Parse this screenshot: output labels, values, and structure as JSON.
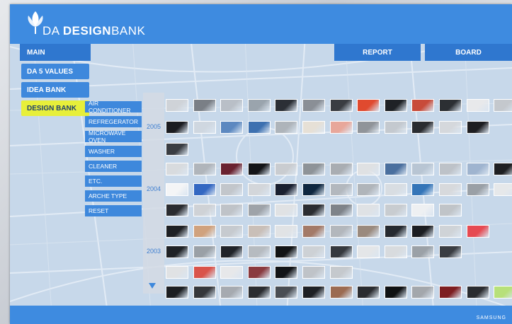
{
  "header": {
    "brand_prefix": "DA ",
    "brand_bold": "DESIGN",
    "brand_thin": "BANK",
    "logo_icon": "lotus-logo-icon"
  },
  "top_nav": {
    "main": "MAIN",
    "report": "REPORT",
    "board": "BOARD"
  },
  "left_nav": [
    "DA 5 VALUES",
    "IDEA BANK",
    "DESIGN BANK"
  ],
  "left_nav_active": "DESIGN BANK",
  "categories": [
    "AIR CONDITIONER",
    "REFREGERATOR",
    "MICROWAVE OVEN",
    "WASHER",
    "CLEANER",
    "ETC.",
    "ARCHE TYPE",
    "RESET"
  ],
  "years": [
    "2005",
    "2004",
    "2003"
  ],
  "bottom_text": "SAMSUNG",
  "colors": {
    "header_blue": "#3e8be0",
    "nav_blue": "#2f77cf",
    "active_yellow": "#e7ef3a",
    "map_bg": "#c9d9ea"
  },
  "thumb_rows": [
    [
      "#cfd3d8",
      "#7a7f86",
      "#b9bfc7",
      "#9aa4ad",
      "#2b2f36",
      "#8a8f96",
      "#3a3d42",
      "#e04a2f",
      "#1f2226",
      "#c84b3a",
      "#2c2f33",
      "#e8e9eb",
      "#c4c8cd",
      "#f3f3f4"
    ],
    [
      "#1b1c20",
      "#cfd7e0",
      "#5c88c0",
      "#3d70b0",
      "#aeb4ba",
      "#e6e0d6",
      "#e8a79a",
      "#909499",
      "#c4c9cf",
      "#2a2c30",
      "#d5d8dc",
      "#1d1d20"
    ],
    [
      "#3a3d42"
    ],
    [
      "#d8dbde",
      "#b0b5bb",
      "#6a2230",
      "#141518",
      "#c9ccd0",
      "#8e9398",
      "#a9adb2",
      "#dfe1e3",
      "#4a6f9e",
      "#b8c5d3",
      "#bdc2c8",
      "#9fb4cf",
      "#1e1f22"
    ],
    [
      "#f4f5f6",
      "#3468c2",
      "#c2c6cb",
      "#d3d6da",
      "#1a2030",
      "#0f2740",
      "#b3b8be",
      "#b0b5ba",
      "#d8dde2",
      "#3475b8",
      "#d7d9dc",
      "#9aa0a6",
      "#e6e8ea",
      "#aab0b6"
    ],
    [
      "#2a2c30",
      "#cfd2d6",
      "#bfc3c8",
      "#9ea3a9",
      "#e0e2e4",
      "#2b2d31",
      "#7e8389",
      "#dfe2e5",
      "#c8ccd0",
      "#eef0f2",
      "#c0c4c8"
    ],
    [
      "#1e2024",
      "#d0a27e",
      "#c6cacf",
      "#c9bfb8",
      "#e1e3e5",
      "#a37a68",
      "#b3b7bc",
      "#9a8a7e",
      "#262a30",
      "#1b1d21",
      "#cfd3d7",
      "#e64a52"
    ],
    [
      "#1f2226",
      "#9aa0a6",
      "#202329",
      "#b6bbc0",
      "#111315",
      "#cdd1d5",
      "#36393e",
      "#e4e6e8",
      "#d8dbde",
      "#9ba1a7",
      "#3a3d42"
    ],
    [
      "#e0e2e4",
      "#d9534a",
      "#e7e8ea",
      "#8a3a3f",
      "#121417",
      "#bfc3c8",
      "#c5c9cd"
    ],
    [
      "#1c1f23",
      "#35373b",
      "#a6aab0",
      "#2b2d31",
      "#4a4e54",
      "#1e2024",
      "#9b6b52",
      "#2a2c30",
      "#0f1113",
      "#a3a7ac",
      "#7d1e22",
      "#2a2c30",
      "#b7e07a",
      "#d7dadd"
    ],
    [
      "#c8ccd0",
      "#a2a7ad",
      "#cfd3d7",
      "#bfc4c9",
      "#e3e5e7",
      "#d7dadd",
      "#aeb3b8",
      "#c9cdd1",
      "#d0d4d8",
      "#d9dcdf",
      "#b9bec3",
      "#6f8fb8"
    ]
  ]
}
